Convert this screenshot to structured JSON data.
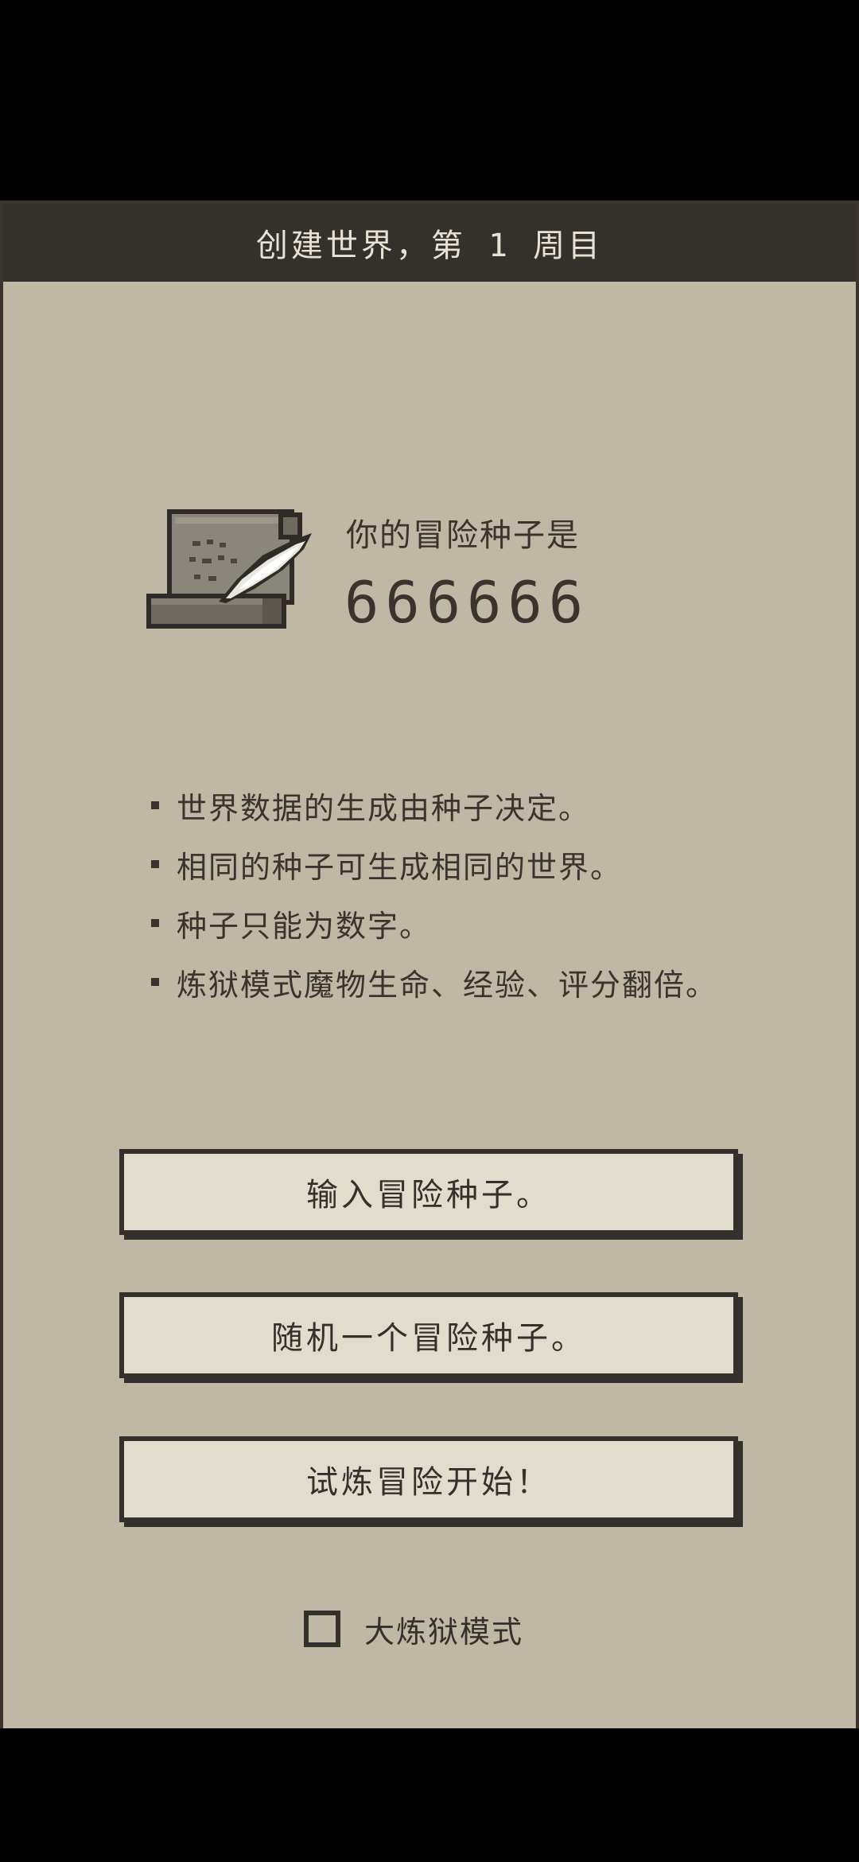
{
  "header": {
    "title": "创建世界，第 1 周目"
  },
  "seed": {
    "label": "你的冒险种子是",
    "value": "666666",
    "icon": "scroll-quill-icon"
  },
  "rules": [
    "世界数据的生成由种子决定。",
    "相同的种子可生成相同的世界。",
    "种子只能为数字。",
    "炼狱模式魔物生命、经验、评分翻倍。"
  ],
  "buttons": {
    "enter_seed": "输入冒险种子。",
    "random_seed": "随机一个冒险种子。",
    "start": "试炼冒险开始！"
  },
  "hardcore": {
    "label": "大炼狱模式",
    "checked": false
  },
  "colors": {
    "background": "#bfb8a5",
    "header": "#34302b",
    "button": "#e2dccf",
    "text": "#3a332e"
  }
}
